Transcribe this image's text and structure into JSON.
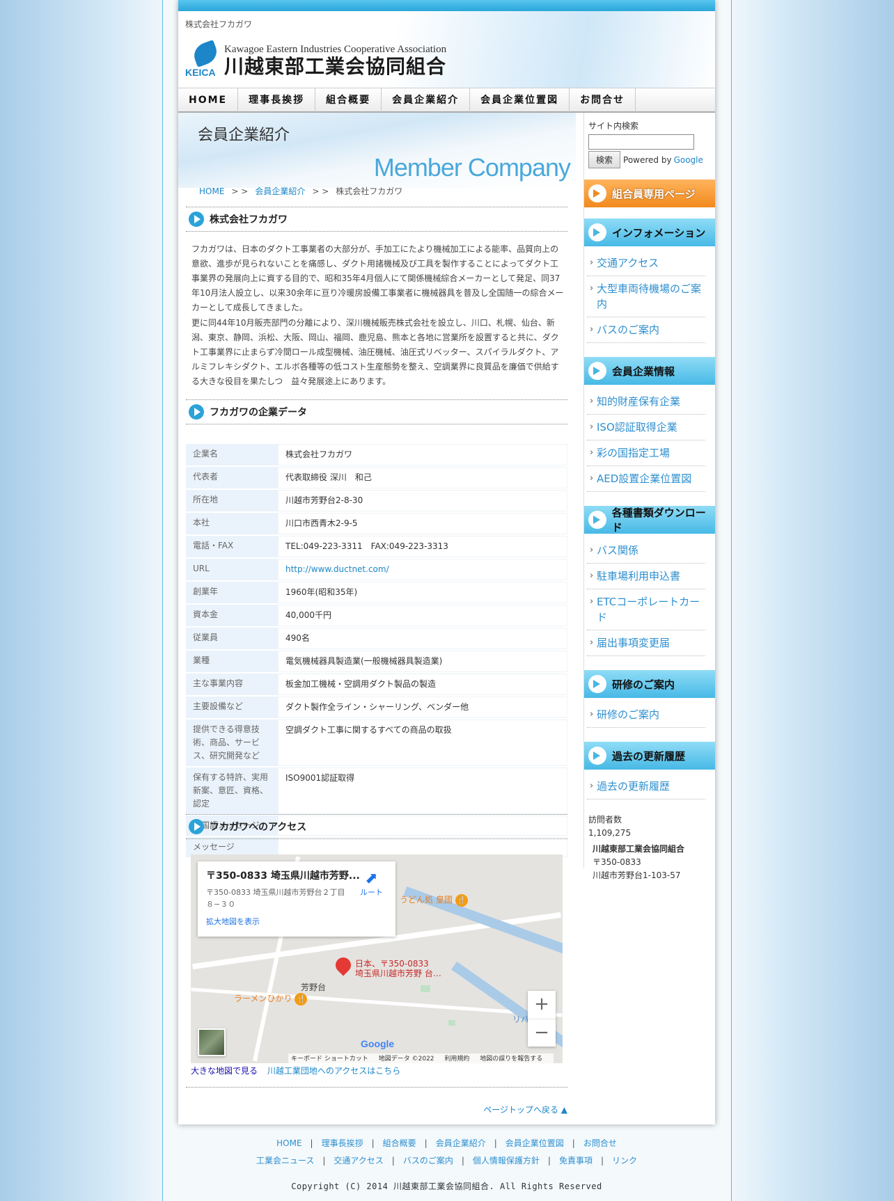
{
  "header": {
    "company_small": "株式会社フカガワ",
    "logo_mark": "KEICA",
    "logo_en": "Kawagoe Eastern Industries Cooperative Association",
    "logo_ja": "川越東部工業会協同組合"
  },
  "nav": [
    "HOME",
    "理事長挨拶",
    "組合概要",
    "会員企業紹介",
    "会員企業位置図",
    "お問合せ"
  ],
  "banner": {
    "title": "会員企業紹介",
    "en": "Member Company"
  },
  "breadcrumb": {
    "home": "HOME",
    "sep": "> >",
    "section": "会員企業紹介",
    "current": "株式会社フカガワ"
  },
  "sections": {
    "company": "株式会社フカガワ",
    "data": "フカガワの企業データ",
    "access": "フカガワへのアクセス"
  },
  "intro": [
    "フカガワは、日本のダクト工事業者の大部分が、手加工にたより機械加工による能率、品質向上の意欲、進歩が見られないことを痛感し、ダクト用諸機械及び工具を製作することによってダクト工事業界の発展向上に資する目的で、昭和35年4月個人にて関係機械綜合メーカーとして発足、同37年10月法人設立し、以来30余年に亘り冷暖房設備工事業者に機械器具を普及し全国随一の綜合メーカーとして成長してきました。",
    "更に同44年10月販売部門の分離により、深川機械販売株式会社を設立し、川口、札幌、仙台、新潟、東京、静岡、浜松、大阪、岡山、福岡、鹿児島、熊本と各地に営業所を設置すると共に、ダクト工事業界に止まらず冷間ロール成型機械、油圧機械、油圧式リベッター、スパイラルダクト、アルミフレキシダクト、エルボ各種等の低コスト生産態勢を整え、空調業界に良質品を廉価で供給する大きな役目を果たしつ　益々発展途上にあります。"
  ],
  "company_data": [
    {
      "k": "企業名",
      "v": "株式会社フカガワ"
    },
    {
      "k": "代表者",
      "v": "代表取締役 深川　和己"
    },
    {
      "k": "所在地",
      "v": "川越市芳野台2-8-30"
    },
    {
      "k": "本社",
      "v": "川口市西青木2-9-5"
    },
    {
      "k": "電話・FAX",
      "v": "TEL:049-223-3311　FAX:049-223-3313"
    },
    {
      "k": "URL",
      "v": "http://www.ductnet.com/"
    },
    {
      "k": "創業年",
      "v": "1960年(昭和35年)"
    },
    {
      "k": "資本金",
      "v": "40,000千円"
    },
    {
      "k": "従業員",
      "v": "490名"
    },
    {
      "k": "業種",
      "v": "電気機械器具製造業(一般機械器具製造業)"
    },
    {
      "k": "主な事業内容",
      "v": "板金加工機械・空調用ダクト製品の製造"
    },
    {
      "k": "主要設備など",
      "v": "ダクト製作全ライン・シャーリング、ベンダー他"
    },
    {
      "k": "提供できる得意技術、商品、サービス、研究開発など",
      "v": "空調ダクト工事に関するすべての商品の取扱"
    },
    {
      "k": "保有する特許、実用新案、意匠、資格、認定",
      "v": "ISO9001認証取得"
    },
    {
      "k": "外国語メッセージ",
      "v": ""
    },
    {
      "k": "メッセージ",
      "v": ""
    }
  ],
  "map": {
    "card_title": "〒350-0833 埼玉県川越市芳野...",
    "card_address": "〒350-0833 埼玉県川越市芳野台２丁目８−３０",
    "card_link": "拡大地図を表示",
    "route": "ルート",
    "pin_label_1": "日本、〒350-0833",
    "pin_label_2": "埼玉県川越市芳野 台…",
    "poi_udon": "うどん処 皇國",
    "poi_ramen": "ラーメンひかり",
    "place": "芳野台",
    "place2": "リバ",
    "google": "Google",
    "foot": [
      "キーボード ショートカット",
      "地図データ ©2022",
      "利用規約",
      "地図の誤りを報告する"
    ],
    "zoom_in": "+",
    "zoom_out": "−",
    "link_large": "大きな地図で見る",
    "link_access": "川越工業団地へのアクセスはこちら"
  },
  "pagetop": "ページトップへ戻る ▲",
  "side": {
    "search_label": "サイト内検索",
    "search_button": "検索",
    "powered": "Powered by",
    "google": "Google",
    "members_page": "組合員専用ページ",
    "info_head": "インフォメーション",
    "info_items": [
      "交通アクセス",
      "大型車両待機場のご案内",
      "バスのご案内"
    ],
    "member_head": "会員企業情報",
    "member_items": [
      "知的財産保有企業",
      "ISO認証取得企業",
      "彩の国指定工場",
      "AED設置企業位置図"
    ],
    "docs_head": "各種書類ダウンロード",
    "docs_items": [
      "バス関係",
      "駐車場利用申込書",
      "ETCコーポレートカード",
      "届出事項変更届"
    ],
    "training_head": "研修のご案内",
    "training_items": [
      "研修のご案内"
    ],
    "history_head": "過去の更新履歴",
    "history_items": [
      "過去の更新履歴"
    ],
    "visits_label": "訪問者数",
    "visits_count": "1,109,275",
    "org_name": "川越東部工業会協同組合",
    "org_zip": "〒350-0833",
    "org_addr": "川越市芳野台1-103-57"
  },
  "footer": {
    "row1": [
      "HOME",
      "理事長挨拶",
      "組合概要",
      "会員企業紹介",
      "会員企業位置図",
      "お問合せ"
    ],
    "row2": [
      "工業会ニュース",
      "交通アクセス",
      "バスのご案内",
      "個人情報保護方針",
      "免責事項",
      "リンク"
    ],
    "separator": "|",
    "copyright": "Copyright (C) 2014 川越東部工業会協同組合. All Rights Reserved"
  },
  "colors": {
    "accent": "#2aa3d8",
    "link": "#1c86c8",
    "orange": "#f28a1e"
  }
}
